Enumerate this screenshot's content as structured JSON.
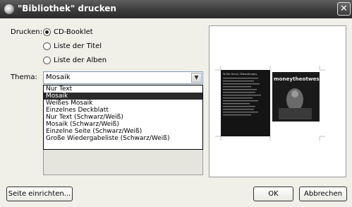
{
  "window": {
    "title": "\"Bibliothek\" drucken"
  },
  "print": {
    "label": "Drucken:",
    "options": [
      "CD-Booklet",
      "Liste der Titel",
      "Liste der Alben"
    ],
    "selected": "CD-Booklet"
  },
  "theme": {
    "label": "Thema:",
    "value": "Mosaik",
    "options": [
      "Nur Text",
      "Mosaik",
      "Weißes Mosaik",
      "Einzelnes Deckblatt",
      "Nur Text (Schwarz/Weiß)",
      "Mosaik (Schwarz/Weiß)",
      "Einzelne Seite (Schwarz/Weiß)",
      "Große Wiedergabeliste (Schwarz/Weiß)"
    ],
    "highlighted": "Mosaik"
  },
  "preview": {
    "header": "To Die Horst / Misanthrophy",
    "cover_text": "moneytheotwes"
  },
  "buttons": {
    "page_setup": "Seite einrichten...",
    "ok": "OK",
    "cancel": "Abbrechen"
  },
  "colors": {
    "titlebar": "#3c3c3c",
    "selection": "#2a2a2a",
    "dialog_bg": "#f0efe8"
  }
}
